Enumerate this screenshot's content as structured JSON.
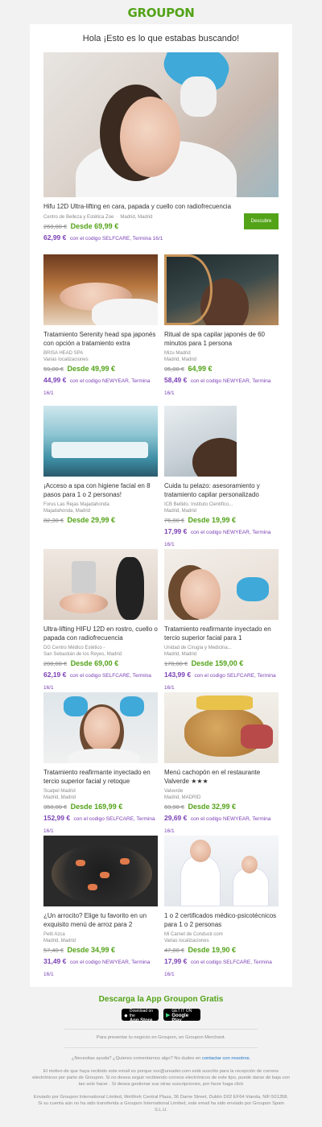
{
  "brand": "GROUPON",
  "greeting": "Hola ¡Esto es lo que estabas buscando!",
  "hero": {
    "title": "Hifu 12D Ultra-lifting en cara, papada y cuello con radiofrecuencia",
    "merchant": "Centro de Belleza y Estética Zoe",
    "location": "Madrid, Madrid",
    "old_price": "260,00 €",
    "price": "Desde 69,99 €",
    "promo_price": "62,99 €",
    "promo_text": "con el codigo SELFCARE, Termina 16/1",
    "button": "Descubre"
  },
  "deals": [
    {
      "title": "Tratamiento Serenity head spa japonés con opción a tratamiento extra",
      "merchant": "BRISA HEAD SPA",
      "location": "Varias localizaciones",
      "old_price": "59,00 €",
      "price": "Desde 49,99 €",
      "promo_price": "44,99 €",
      "promo_text": "con el codigo NEWYEAR, Termina 16/1"
    },
    {
      "title": "Ritual de spa capilar japonés de 60 minutos para 1 persona",
      "merchant": "Mizu Madrid",
      "location": "Madrid, Madrid",
      "old_price": "95,00 €",
      "price": "64,99 €",
      "promo_price": "58,49 €",
      "promo_text": "con el codigo NEWYEAR, Termina 16/1"
    },
    {
      "title": "¡Acceso a spa con higiene facial en 8 pasos para 1 o 2 personas!",
      "merchant": "Forus Las Rejas Majadahonda",
      "location": "Majadahonda, Madrid",
      "old_price": "82,30 €",
      "price": "Desde 29,99 €",
      "promo_price": "",
      "promo_text": ""
    },
    {
      "title": "Cuida tu pelazo: asesoramiento y tratamiento capilar personalizado",
      "merchant": "ICB Bellido. Instituto Cientifico...",
      "location": "Madrid, Madrid",
      "old_price": "76,00 €",
      "price": "Desde 19,99 €",
      "promo_price": "17,99 €",
      "promo_text": "con el codigo NEWYEAR, Termina 16/1"
    },
    {
      "title": "Ultra-lifting HIFU 12D en rostro, cuello o papada con radiofrecuencia",
      "merchant": "DG Centro Médico Estético -",
      "location": "San Sebastián de los Reyes, Madrid",
      "old_price": "200,00 €",
      "price": "Desde 69,00 €",
      "promo_price": "62,19 €",
      "promo_text": "con el codigo SELFCARE, Termina 16/1"
    },
    {
      "title": "Tratamiento reafirmante inyectado en tercio superior facial para 1",
      "merchant": "Unidad de Cirugía y Medicina...",
      "location": "Madrid, Madrid",
      "old_price": "170,00 €",
      "price": "Desde 159,00 €",
      "promo_price": "143,99 €",
      "promo_text": "con el codigo SELFCARE, Termina 16/1"
    },
    {
      "title": "Tratamiento reafirmante inyectado en tercio superior facial y retoque",
      "merchant": "Scalpel Madrid",
      "location": "Madrid, Madrid",
      "old_price": "350,00 €",
      "price": "Desde 169,99 €",
      "promo_price": "152,99 €",
      "promo_text": "con el codigo SELFCARE, Termina 16/1"
    },
    {
      "title": "Menú cachopón en el restaurante Valverde ★★★",
      "merchant": "Valverde",
      "location": "Madrid, MADRID",
      "old_price": "69,90 €",
      "price": "Desde 32,99 €",
      "promo_price": "29,69 €",
      "promo_text": "con el codigo NEWYEAR, Termina 16/1"
    },
    {
      "title": "¿Un arrocito? Elige tu favorito en un exquisito menú de arroz para 2",
      "merchant": "Petit Azca",
      "location": "Madrid, Madrid",
      "old_price": "57,40 €",
      "price": "Desde 34,99 €",
      "promo_price": "31,49 €",
      "promo_text": "con el codigo NEWYEAR, Termina 16/1"
    },
    {
      "title": "1 o 2 certificados médico-psicotécnicos para 1 o 2 personas",
      "merchant": "Mi Carnet de Conducir.com",
      "location": "Varias localizaciones",
      "old_price": "47,00 €",
      "price": "Desde 19,90 €",
      "promo_price": "17,99 €",
      "promo_text": "con el codigo SELFCARE, Termina 16/1"
    }
  ],
  "footer": {
    "app_title": "Descarga la App Groupon Gratis",
    "appstore_small": "Download on the",
    "appstore": "App Store",
    "gplay_small": "GET IT ON",
    "gplay": "Google Play",
    "merchant_line": "Para presentar tu negocio en Groupon, en Groupon Merchant.",
    "help_text": "¿Necesitas ayuda? ¿Quieres comentarnos algo? No dudes en",
    "help_link": "contactar con nosotros.",
    "reason": "El motivo de que haya recibido este email es porque xxx@ureader.com está suscrito para la recepción de correos electrónicos por parte de Groupon. Si no desea seguir recibiendo correos electrónicos de este tipo, puede darse de baja con tan solo hacer . Si desea gestionar sus otras suscripciones, por favor haga click",
    "sender": "Enviado por Groupon International Limited, WeWork Central Plaza, 36 Dame Street, Dublin D02 EF64 Irlanda, NIF:501358. Si su cuenta aún no ha sido transferida a Groupon International Limited, este email ha sido enviado por Groupon Spain S.L.U."
  },
  "colors": {
    "brand_green": "#53a318",
    "promo_purple": "#7a3fb5",
    "link_blue": "#1a73c8"
  }
}
